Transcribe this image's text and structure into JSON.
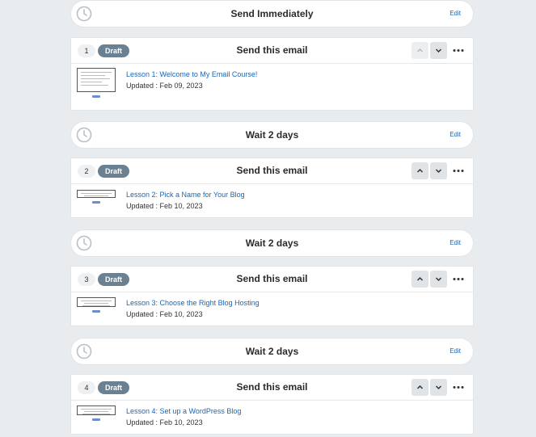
{
  "waits": [
    {
      "title": "Send Immediately",
      "edit": "Edit",
      "clock_icon": "clock-icon"
    },
    {
      "title": "Wait 2 days",
      "edit": "Edit",
      "clock_icon": "clock-icon"
    },
    {
      "title": "Wait 2 days",
      "edit": "Edit",
      "clock_icon": "clock-icon"
    },
    {
      "title": "Wait 2 days",
      "edit": "Edit",
      "clock_icon": "clock-icon"
    }
  ],
  "emails": [
    {
      "number": "1",
      "status": "Draft",
      "title": "Send this email",
      "subject": "Lesson 1: Welcome to My Email Course!",
      "updated": "Updated : Feb 09, 2023",
      "move_up_enabled": false
    },
    {
      "number": "2",
      "status": "Draft",
      "title": "Send this email",
      "subject": "Lesson 2: Pick a Name for Your Blog",
      "updated": "Updated : Feb 10, 2023",
      "move_up_enabled": true
    },
    {
      "number": "3",
      "status": "Draft",
      "title": "Send this email",
      "subject": "Lesson 3: Choose the Right Blog Hosting",
      "updated": "Updated : Feb 10, 2023",
      "move_up_enabled": true
    },
    {
      "number": "4",
      "status": "Draft",
      "title": "Send this email",
      "subject": "Lesson 4: Set up a WordPress Blog",
      "updated": "Updated : Feb 10, 2023",
      "move_up_enabled": true
    }
  ],
  "colors": {
    "background": "#e9ecef",
    "draft_badge": "#6b8192",
    "link": "#1a66b5"
  },
  "icons": {
    "move_up": "chevron-up-icon",
    "move_down": "chevron-down-icon",
    "more": "more-horizontal-icon",
    "wait": "clock-icon"
  }
}
